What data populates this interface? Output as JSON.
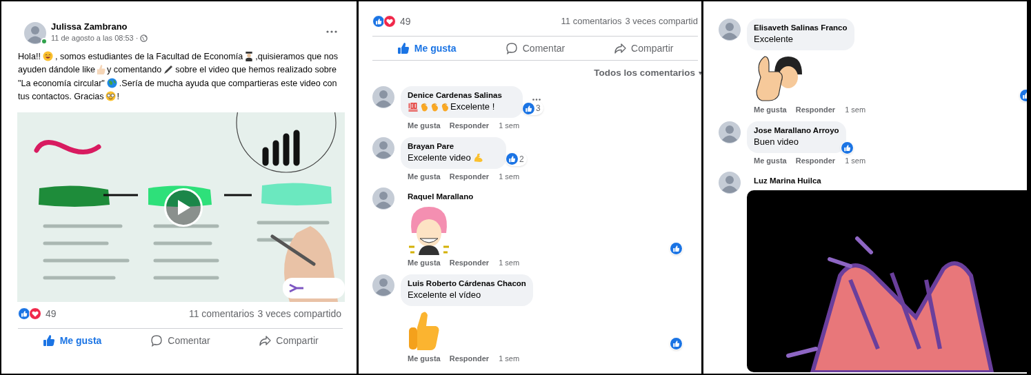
{
  "post": {
    "author": "Julissa Zambrano",
    "time": "11 de agosto a las 08:53 ·",
    "online": true,
    "body": [
      "Hola!!",
      ", somos estudiantes de la Facultad de Economía",
      ",quisieramos que nos ayuden dándole like",
      "y comentando",
      "sobre el video que hemos realizado sobre \"La economía circular\"",
      ".Sería de mucha ayuda que compartieras este video con tus contactos. Gracias",
      "!"
    ],
    "reactions_count": "49",
    "comments_count": "11 comentarios",
    "shares_count": "3 veces compartido",
    "actions": [
      {
        "kind": "like",
        "label": "Me gusta",
        "selected": true
      },
      {
        "kind": "comment",
        "label": "Comentar",
        "selected": false
      },
      {
        "kind": "share",
        "label": "Compartir",
        "selected": false
      }
    ]
  },
  "comments_panel": {
    "reactions_count": "49",
    "comments_count": "11 comentarios",
    "shares_count": "3 veces compartid",
    "actions": [
      {
        "kind": "like",
        "label": "Me gusta",
        "selected": true
      },
      {
        "kind": "comment",
        "label": "Comentar",
        "selected": false
      },
      {
        "kind": "share",
        "label": "Compartir",
        "selected": false
      }
    ],
    "filter": "Todos los comentarios",
    "comments": [
      {
        "author": "Denice Cardenas Salinas",
        "text": "Excelente !",
        "liked": true,
        "like_count": "3",
        "more": true,
        "meta": [
          "Me gusta",
          "Responder",
          "1 sem"
        ]
      },
      {
        "author": "Brayan Pare",
        "text": "Excelente video",
        "liked": true,
        "like_count": "2",
        "meta": [
          "Me gusta",
          "Responder",
          "1 sem"
        ]
      },
      {
        "author": "Raquel Marallano",
        "media": {
          "kind": "picture"
        },
        "liked": true,
        "meta": [
          "Me gusta",
          "Responder",
          "1 sem"
        ]
      },
      {
        "author": "Luis Roberto Cárdenas Chacon",
        "text": "Excelente el vídeo",
        "media": {
          "kind": "picture"
        },
        "liked": true,
        "meta": [
          "Me gusta",
          "Responder",
          "1 sem"
        ]
      }
    ]
  },
  "more_comments": {
    "comments": [
      {
        "author": "Elisaveth Salinas Franco",
        "text": "Excelente",
        "media": {
          "kind": "picture"
        },
        "liked": true,
        "meta": [
          "Me gusta",
          "Responder",
          "1 sem"
        ]
      },
      {
        "author": "Jose Marallano Arroyo",
        "text": "Buen video",
        "liked": true,
        "meta": [
          "Me gusta",
          "Responder",
          "1 sem"
        ]
      },
      {
        "author": "Luz Marina Huilca",
        "media": {
          "kind": "picture"
        }
      }
    ]
  }
}
